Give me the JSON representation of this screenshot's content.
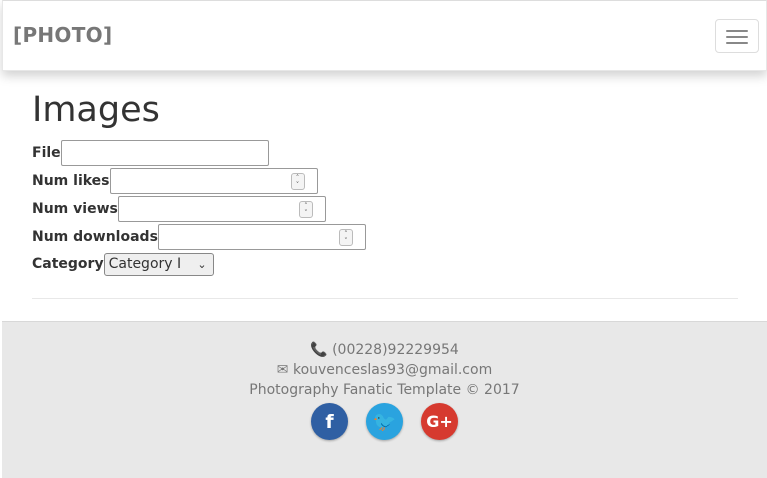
{
  "navbar": {
    "brand": "[PHOTO]"
  },
  "page": {
    "title": "Images"
  },
  "form": {
    "file_label": "File",
    "num_likes_label": "Num likes",
    "num_views_label": "Num views",
    "num_downloads_label": "Num downloads",
    "category_label": "Category",
    "category_selected": "Category I"
  },
  "footer": {
    "phone": "(00228)92229954",
    "email": "kouvenceslas93@gmail.com",
    "copyright": "Photography Fanatic Template © 2017",
    "social": {
      "facebook_glyph": "f",
      "twitter_glyph": "🐦",
      "googleplus_glyph": "G+"
    }
  },
  "colors": {
    "facebook": "#2f5fa3",
    "twitter": "#2aa3df",
    "googleplus": "#d63a2f",
    "footer_bg": "#e8e8e8"
  }
}
